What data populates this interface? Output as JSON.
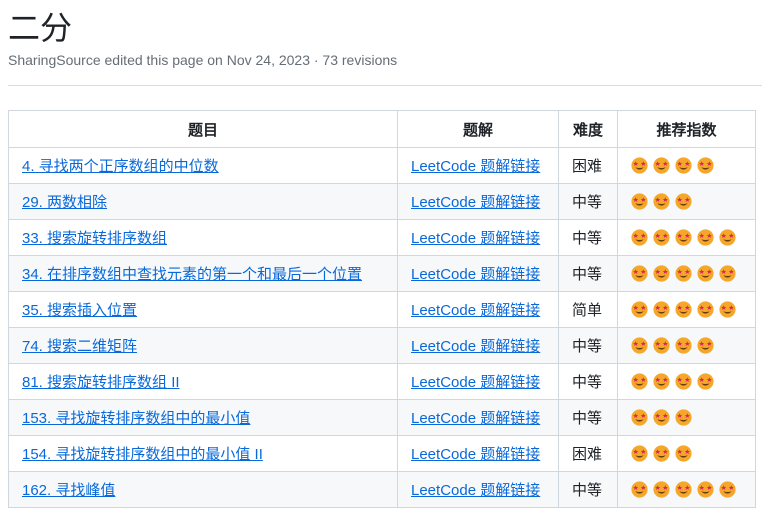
{
  "page": {
    "title": "二分",
    "meta": "SharingSource edited this page on Nov 24, 2023 · 73 revisions"
  },
  "table": {
    "headers": [
      "题目",
      "题解",
      "难度",
      "推荐指数"
    ],
    "icon": "star-struck-emoji-icon",
    "rows": [
      {
        "problem": "4. 寻找两个正序数组的中位数",
        "solution": "LeetCode 题解链接",
        "difficulty": "困难",
        "rating": 4
      },
      {
        "problem": "29. 两数相除",
        "solution": "LeetCode 题解链接",
        "difficulty": "中等",
        "rating": 3
      },
      {
        "problem": "33. 搜索旋转排序数组",
        "solution": "LeetCode 题解链接",
        "difficulty": "中等",
        "rating": 5
      },
      {
        "problem": "34. 在排序数组中查找元素的第一个和最后一个位置",
        "solution": "LeetCode 题解链接",
        "difficulty": "中等",
        "rating": 5
      },
      {
        "problem": "35. 搜索插入位置",
        "solution": "LeetCode 题解链接",
        "difficulty": "简单",
        "rating": 5
      },
      {
        "problem": "74. 搜索二维矩阵",
        "solution": "LeetCode 题解链接",
        "difficulty": "中等",
        "rating": 4
      },
      {
        "problem": "81. 搜索旋转排序数组 II",
        "solution": "LeetCode 题解链接",
        "difficulty": "中等",
        "rating": 4
      },
      {
        "problem": "153. 寻找旋转排序数组中的最小值",
        "solution": "LeetCode 题解链接",
        "difficulty": "中等",
        "rating": 3
      },
      {
        "problem": "154. 寻找旋转排序数组中的最小值 II",
        "solution": "LeetCode 题解链接",
        "difficulty": "困难",
        "rating": 3
      },
      {
        "problem": "162. 寻找峰值",
        "solution": "LeetCode 题解链接",
        "difficulty": "中等",
        "rating": 5
      }
    ]
  },
  "colors": {
    "link": "#0969da",
    "border": "#d0d7de",
    "stripe": "#f6f8fa",
    "emoji_face": "#f4a72a",
    "emoji_eye": "#e0245e"
  }
}
